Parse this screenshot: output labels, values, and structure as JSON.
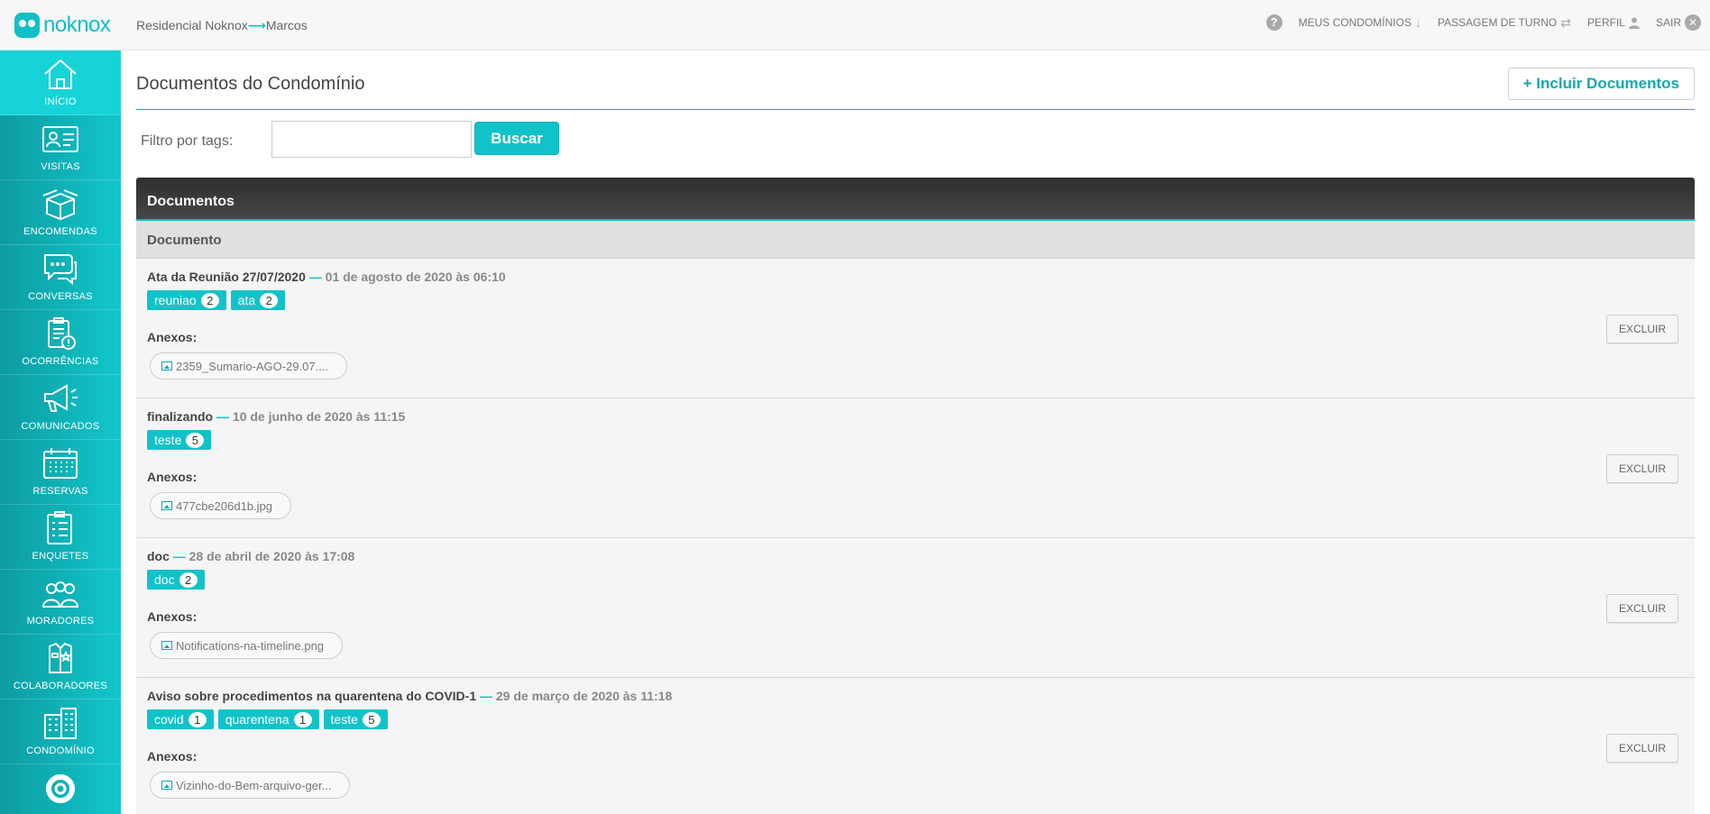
{
  "app": {
    "logo_text": "noknox"
  },
  "breadcrumb": {
    "condo": "Residencial Noknox",
    "arrow": "⟶",
    "user": "Marcos"
  },
  "topnav": {
    "help": "?",
    "meus_condominios": "MEUS CONDOMÍNIOS",
    "passagem_turno": "PASSAGEM DE TURNO",
    "perfil": "PERFIL",
    "sair": "SAIR"
  },
  "sidebar": {
    "items": [
      {
        "label": "INÍCIO",
        "icon": "home-icon"
      },
      {
        "label": "VISITAS",
        "icon": "id-card-icon"
      },
      {
        "label": "ENCOMENDAS",
        "icon": "package-icon"
      },
      {
        "label": "CONVERSAS",
        "icon": "chat-icon"
      },
      {
        "label": "OCORRÊNCIAS",
        "icon": "clipboard-alert-icon"
      },
      {
        "label": "COMUNICADOS",
        "icon": "megaphone-icon"
      },
      {
        "label": "RESERVAS",
        "icon": "calendar-icon"
      },
      {
        "label": "ENQUETES",
        "icon": "checklist-icon"
      },
      {
        "label": "MORADORES",
        "icon": "people-icon"
      },
      {
        "label": "COLABORADORES",
        "icon": "uniform-icon"
      },
      {
        "label": "CONDOMÍNIO",
        "icon": "building-icon"
      }
    ]
  },
  "page": {
    "title": "Documentos do Condomínio",
    "add_button": "+ Incluir Documentos",
    "filter_label": "Filtro por tags:",
    "filter_value": "",
    "search_button": "Buscar"
  },
  "panel": {
    "title": "Documentos",
    "column": "Documento",
    "anexos_label": "Anexos:",
    "delete_label": "EXCLUIR",
    "separator": "—"
  },
  "documents": [
    {
      "title": "Ata da Reunião 27/07/2020",
      "date": "01 de agosto de 2020 às 06:10",
      "tags": [
        {
          "name": "reuniao",
          "count": "2"
        },
        {
          "name": "ata",
          "count": "2"
        }
      ],
      "file": "2359_Sumario-AGO-29.07...."
    },
    {
      "title": "finalizando",
      "date": "10 de junho de 2020 às 11:15",
      "tags": [
        {
          "name": "teste",
          "count": "5"
        }
      ],
      "file": "477cbe206d1b.jpg"
    },
    {
      "title": "doc",
      "date": "28 de abril de 2020 às 17:08",
      "tags": [
        {
          "name": "doc",
          "count": "2"
        }
      ],
      "file": "Notifications-na-timeline.png"
    },
    {
      "title": "Aviso sobre procedimentos na quarentena do COVID-1",
      "date": "29 de março de 2020 às 11:18",
      "tags": [
        {
          "name": "covid",
          "count": "1"
        },
        {
          "name": "quarentena",
          "count": "1"
        },
        {
          "name": "teste",
          "count": "5"
        }
      ],
      "file": "Vizinho-do-Bem-arquivo-ger..."
    }
  ],
  "colors": {
    "accent": "#11c3c8",
    "panel_head": "#3a3a3a",
    "row_bg": "#f5f5f5"
  }
}
